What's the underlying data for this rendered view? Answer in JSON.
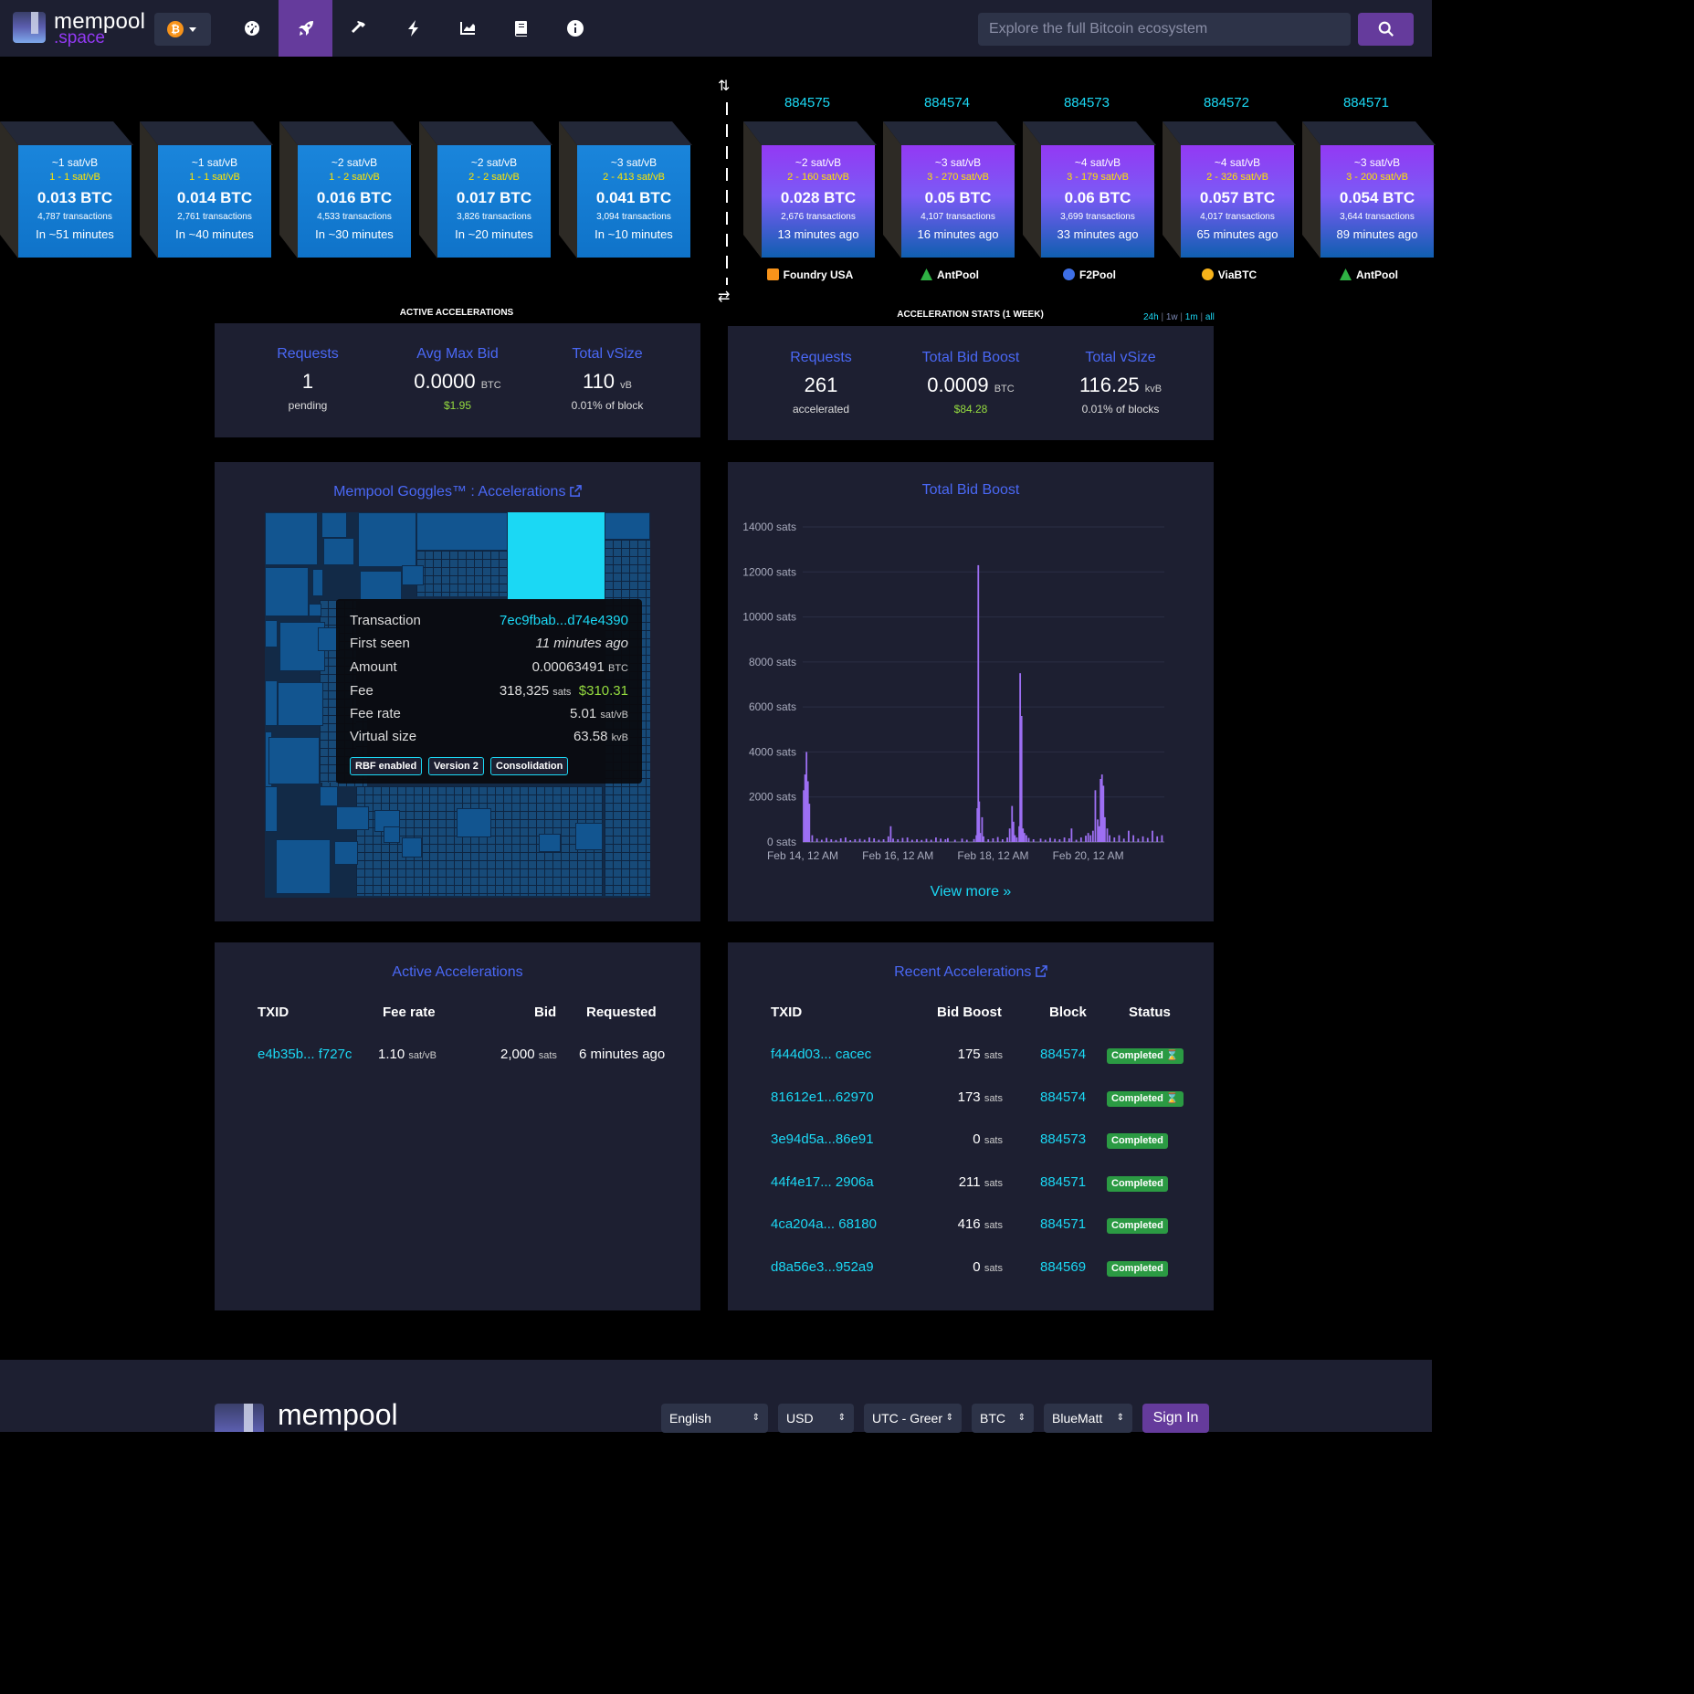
{
  "header": {
    "logo_top": "mempool",
    "logo_bottom": ".space",
    "network_symbol": "₿",
    "search_placeholder": "Explore the full Bitcoin ecosystem",
    "nav_icons": [
      "dashboard-icon",
      "rocket-icon",
      "hammer-icon",
      "lightning-icon",
      "chart-icon",
      "book-icon",
      "info-icon"
    ]
  },
  "mempool_blocks": [
    {
      "fee": "~1 sat/vB",
      "range": "1 - 1 sat/vB",
      "size": "0.013 BTC",
      "txs": "4,787 transactions",
      "eta": "In ~51 minutes"
    },
    {
      "fee": "~1 sat/vB",
      "range": "1 - 1 sat/vB",
      "size": "0.014 BTC",
      "txs": "2,761 transactions",
      "eta": "In ~40 minutes"
    },
    {
      "fee": "~2 sat/vB",
      "range": "1 - 2 sat/vB",
      "size": "0.016 BTC",
      "txs": "4,533 transactions",
      "eta": "In ~30 minutes"
    },
    {
      "fee": "~2 sat/vB",
      "range": "2 - 2 sat/vB",
      "size": "0.017 BTC",
      "txs": "3,826 transactions",
      "eta": "In ~20 minutes"
    },
    {
      "fee": "~3 sat/vB",
      "range": "2 - 413 sat/vB",
      "size": "0.041 BTC",
      "txs": "3,094 transactions",
      "eta": "In ~10 minutes"
    }
  ],
  "mined_blocks": [
    {
      "height": "884575",
      "fee": "~2 sat/vB",
      "range": "2 - 160 sat/vB",
      "size": "0.028 BTC",
      "txs": "2,676 transactions",
      "time": "13 minutes ago",
      "pool": "Foundry USA",
      "pool_color": "#f7931a"
    },
    {
      "height": "884574",
      "fee": "~3 sat/vB",
      "range": "3 - 270 sat/vB",
      "size": "0.05 BTC",
      "txs": "4,107 transactions",
      "time": "16 minutes ago",
      "pool": "AntPool",
      "pool_color": "#2fb344"
    },
    {
      "height": "884573",
      "fee": "~4 sat/vB",
      "range": "3 - 179 sat/vB",
      "size": "0.06 BTC",
      "txs": "3,699 transactions",
      "time": "33 minutes ago",
      "pool": "F2Pool",
      "pool_color": "#3e6fe6"
    },
    {
      "height": "884572",
      "fee": "~4 sat/vB",
      "range": "2 - 326 sat/vB",
      "size": "0.057 BTC",
      "txs": "4,017 transactions",
      "time": "65 minutes ago",
      "pool": "ViaBTC",
      "pool_color": "#f7b31a"
    },
    {
      "height": "884571",
      "fee": "~3 sat/vB",
      "range": "3 - 200 sat/vB",
      "size": "0.054 BTC",
      "txs": "3,644 transactions",
      "time": "89 minutes ago",
      "pool": "AntPool",
      "pool_color": "#2fb344"
    }
  ],
  "active_stats": {
    "header": "ACTIVE ACCELERATIONS",
    "requests_label": "Requests",
    "requests_value": "1",
    "requests_sub": "pending",
    "bid_label": "Avg Max Bid",
    "bid_value": "0.0000",
    "bid_unit": "BTC",
    "bid_usd": "$1.95",
    "vsize_label": "Total vSize",
    "vsize_value": "110",
    "vsize_unit": "vB",
    "vsize_sub": "0.01% of block"
  },
  "week_stats": {
    "header": "ACCELERATION STATS",
    "header_period": "(1 WEEK)",
    "ranges": [
      "24h",
      "1w",
      "1m",
      "all"
    ],
    "requests_label": "Requests",
    "requests_value": "261",
    "requests_sub": "accelerated",
    "boost_label": "Total Bid Boost",
    "boost_value": "0.0009",
    "boost_unit": "BTC",
    "boost_usd": "$84.28",
    "vsize_label": "Total vSize",
    "vsize_value": "116.25",
    "vsize_unit": "kvB",
    "vsize_sub": "0.01% of blocks"
  },
  "goggles": {
    "title": "Mempool Goggles™ : Accelerations",
    "tooltip": {
      "tx_label": "Transaction",
      "tx_value": "7ec9fbab...d74e4390",
      "seen_label": "First seen",
      "seen_value": "11 minutes ago",
      "amount_label": "Amount",
      "amount_value": "0.00063491",
      "amount_unit": "BTC",
      "fee_label": "Fee",
      "fee_value": "318,325",
      "fee_unit": "sats",
      "fee_usd": "$310.31",
      "rate_label": "Fee rate",
      "rate_value": "5.01",
      "rate_unit": "sat/vB",
      "vsize_label": "Virtual size",
      "vsize_value": "63.58",
      "vsize_unit": "kvB",
      "badges": [
        "RBF enabled",
        "Version 2",
        "Consolidation"
      ]
    }
  },
  "bid_chart": {
    "title": "Total Bid Boost",
    "view_more": "View more »"
  },
  "chart_data": {
    "type": "bar",
    "title": "Total Bid Boost",
    "ylim": [
      0,
      14000
    ],
    "y_ticks": [
      "0 sats",
      "2000 sats",
      "4000 sats",
      "6000 sats",
      "8000 sats",
      "10000 sats",
      "12000 sats",
      "14000 sats"
    ],
    "y_tick_values": [
      0,
      2000,
      4000,
      6000,
      8000,
      10000,
      12000,
      14000
    ],
    "x_ticks": [
      "Feb 14, 12 AM",
      "Feb 16, 12 AM",
      "Feb 18, 12 AM",
      "Feb 20, 12 AM"
    ],
    "x_range_days": [
      0,
      7.6
    ],
    "x_tick_days": [
      0,
      2,
      4,
      6
    ],
    "series": [
      {
        "color": "#9d6ff3",
        "points": [
          [
            0.02,
            2300
          ],
          [
            0.05,
            3000
          ],
          [
            0.08,
            4000
          ],
          [
            0.11,
            2700
          ],
          [
            0.14,
            1700
          ],
          [
            0.2,
            300
          ],
          [
            0.3,
            150
          ],
          [
            0.4,
            100
          ],
          [
            0.5,
            180
          ],
          [
            0.6,
            120
          ],
          [
            0.7,
            90
          ],
          [
            0.8,
            160
          ],
          [
            0.9,
            200
          ],
          [
            1.0,
            80
          ],
          [
            1.1,
            120
          ],
          [
            1.2,
            140
          ],
          [
            1.3,
            100
          ],
          [
            1.4,
            200
          ],
          [
            1.5,
            160
          ],
          [
            1.6,
            100
          ],
          [
            1.7,
            120
          ],
          [
            1.8,
            250
          ],
          [
            1.85,
            700
          ],
          [
            1.9,
            150
          ],
          [
            2.0,
            120
          ],
          [
            2.1,
            180
          ],
          [
            2.2,
            200
          ],
          [
            2.3,
            100
          ],
          [
            2.4,
            120
          ],
          [
            2.5,
            90
          ],
          [
            2.6,
            140
          ],
          [
            2.7,
            100
          ],
          [
            2.8,
            200
          ],
          [
            2.9,
            150
          ],
          [
            3.0,
            120
          ],
          [
            3.05,
            170
          ],
          [
            3.2,
            100
          ],
          [
            3.35,
            150
          ],
          [
            3.45,
            100
          ],
          [
            3.6,
            130
          ],
          [
            3.65,
            300
          ],
          [
            3.67,
            1500
          ],
          [
            3.69,
            12300
          ],
          [
            3.71,
            1800
          ],
          [
            3.73,
            400
          ],
          [
            3.77,
            1100
          ],
          [
            3.8,
            250
          ],
          [
            3.9,
            120
          ],
          [
            4.0,
            160
          ],
          [
            4.1,
            220
          ],
          [
            4.2,
            120
          ],
          [
            4.3,
            200
          ],
          [
            4.35,
            600
          ],
          [
            4.4,
            1600
          ],
          [
            4.43,
            900
          ],
          [
            4.46,
            300
          ],
          [
            4.5,
            200
          ],
          [
            4.55,
            700
          ],
          [
            4.57,
            7500
          ],
          [
            4.6,
            5600
          ],
          [
            4.63,
            600
          ],
          [
            4.66,
            400
          ],
          [
            4.7,
            300
          ],
          [
            4.75,
            180
          ],
          [
            4.85,
            120
          ],
          [
            5.0,
            150
          ],
          [
            5.1,
            100
          ],
          [
            5.2,
            180
          ],
          [
            5.3,
            140
          ],
          [
            5.4,
            120
          ],
          [
            5.5,
            200
          ],
          [
            5.6,
            160
          ],
          [
            5.65,
            600
          ],
          [
            5.75,
            100
          ],
          [
            5.85,
            200
          ],
          [
            5.95,
            280
          ],
          [
            6.0,
            400
          ],
          [
            6.05,
            300
          ],
          [
            6.1,
            500
          ],
          [
            6.15,
            2300
          ],
          [
            6.2,
            1000
          ],
          [
            6.23,
            700
          ],
          [
            6.26,
            2800
          ],
          [
            6.29,
            3000
          ],
          [
            6.32,
            2500
          ],
          [
            6.35,
            1100
          ],
          [
            6.4,
            600
          ],
          [
            6.45,
            300
          ],
          [
            6.55,
            200
          ],
          [
            6.65,
            300
          ],
          [
            6.75,
            150
          ],
          [
            6.85,
            500
          ],
          [
            6.95,
            300
          ],
          [
            7.05,
            150
          ],
          [
            7.15,
            250
          ],
          [
            7.25,
            180
          ],
          [
            7.35,
            500
          ],
          [
            7.45,
            250
          ],
          [
            7.55,
            300
          ]
        ]
      }
    ]
  },
  "active_table": {
    "title": "Active Accelerations",
    "headers": [
      "TXID",
      "Fee rate",
      "Bid",
      "Requested"
    ],
    "rows": [
      {
        "txid": "e4b35b... f727c",
        "rate": "1.10",
        "rate_unit": "sat/vB",
        "bid": "2,000",
        "bid_unit": "sats",
        "requested": "6 minutes ago"
      }
    ]
  },
  "recent_table": {
    "title": "Recent Accelerations",
    "headers": [
      "TXID",
      "Bid Boost",
      "Block",
      "Status"
    ],
    "rows": [
      {
        "txid": "f444d03... cacec",
        "boost": "175",
        "unit": "sats",
        "block": "884574",
        "status": "Completed",
        "pending": true
      },
      {
        "txid": "81612e1...62970",
        "boost": "173",
        "unit": "sats",
        "block": "884574",
        "status": "Completed",
        "pending": true
      },
      {
        "txid": "3e94d5a...86e91",
        "boost": "0",
        "unit": "sats",
        "block": "884573",
        "status": "Completed",
        "pending": false
      },
      {
        "txid": "44f4e17... 2906a",
        "boost": "211",
        "unit": "sats",
        "block": "884571",
        "status": "Completed",
        "pending": false
      },
      {
        "txid": "4ca204a... 68180",
        "boost": "416",
        "unit": "sats",
        "block": "884571",
        "status": "Completed",
        "pending": false
      },
      {
        "txid": "d8a56e3...952a9",
        "boost": "0",
        "unit": "sats",
        "block": "884569",
        "status": "Completed",
        "pending": false
      }
    ]
  },
  "footer": {
    "logo": "mempool",
    "language": "English",
    "currency": "USD",
    "timezone": "UTC - Greer",
    "unit": "BTC",
    "theme": "BlueMatt",
    "signin": "Sign In"
  }
}
